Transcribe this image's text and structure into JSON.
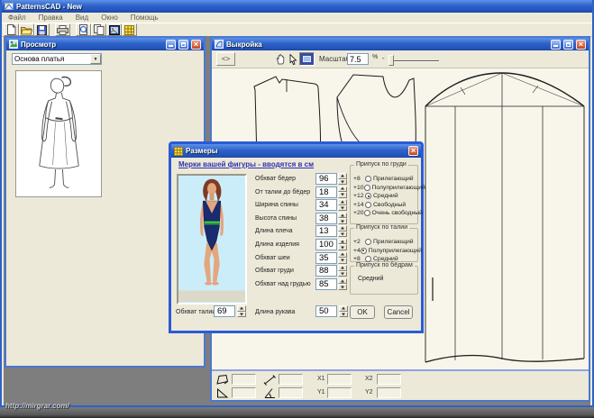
{
  "app": {
    "title": "PatternsCAD - New",
    "menu": [
      "Файл",
      "Правка",
      "Вид",
      "Окно",
      "Помощь"
    ],
    "toolbar_icons": [
      "new-file-icon",
      "open-folder-icon",
      "save-icon",
      "print-icon",
      "print-preview-icon",
      "copy-icon",
      "image-icon",
      "grid-icon"
    ],
    "watermark": "http://mirgrar.com/"
  },
  "preview_window": {
    "title": "Просмотр",
    "dropdown_value": "Основа платья"
  },
  "pattern_window": {
    "title": "Выкройка",
    "fit_button_label": "<>",
    "tool_icons": [
      "pan-hand-icon",
      "select-cursor-icon",
      "zoom-window-icon"
    ],
    "scale_label": "Масштаб",
    "scale_value": "7.5",
    "scale_unit": "%",
    "slider_min_label": "-",
    "bottom_panel": {
      "shape_icons": [
        "shape-quad-icon",
        "shape-length-icon",
        "shape-triangle-icon",
        "shape-angle-icon"
      ],
      "field1": "",
      "field2": "",
      "field3": "",
      "field4": "",
      "x1_label": "X1",
      "y1_label": "Y1",
      "x2_label": "X2",
      "y2_label": "Y2",
      "x1_value": "",
      "y1_value": "",
      "x2_value": "",
      "y2_value": ""
    }
  },
  "sizes_dialog": {
    "title": "Размеры",
    "header": "Мерки вашей фигуры - вводятся в см",
    "measurements": [
      {
        "label": "Обхват бёдер",
        "value": "96"
      },
      {
        "label": "От талии до бёдер",
        "value": "18"
      },
      {
        "label": "Ширина спины",
        "value": "34"
      },
      {
        "label": "Высота спины",
        "value": "38"
      },
      {
        "label": "Длина плеча",
        "value": "13"
      },
      {
        "label": "Длина изделия",
        "value": "100"
      },
      {
        "label": "Обхват шеи",
        "value": "35"
      },
      {
        "label": "Обхват груди",
        "value": "88"
      },
      {
        "label": "Обхват над грудью",
        "value": "85"
      }
    ],
    "waist": {
      "label": "Обхват талии",
      "value": "69"
    },
    "sleeve": {
      "label": "Длина рукава",
      "value": "50"
    },
    "chest_group": {
      "title": "Припуск по груди",
      "options": [
        {
          "prefix": "+8",
          "label": "Прилегающий",
          "selected": false
        },
        {
          "prefix": "+10",
          "label": "Полуприлегающий",
          "selected": false
        },
        {
          "prefix": "+12",
          "label": "Средний",
          "selected": true
        },
        {
          "prefix": "+14",
          "label": "Свободный",
          "selected": false
        },
        {
          "prefix": "+20",
          "label": "Очень свободный",
          "selected": false
        }
      ]
    },
    "waist_group": {
      "title": "Припуск по талии",
      "options": [
        {
          "prefix": "+2",
          "label": "Прилегающий",
          "selected": false
        },
        {
          "prefix": "+4",
          "label": "Полуприлегающий",
          "selected": true
        },
        {
          "prefix": "+8",
          "label": "Средний",
          "selected": false
        }
      ]
    },
    "hips_group": {
      "title": "Припуск по бёдрам",
      "value": "Средний"
    },
    "ok_label": "OK",
    "cancel_label": "Cancel"
  }
}
